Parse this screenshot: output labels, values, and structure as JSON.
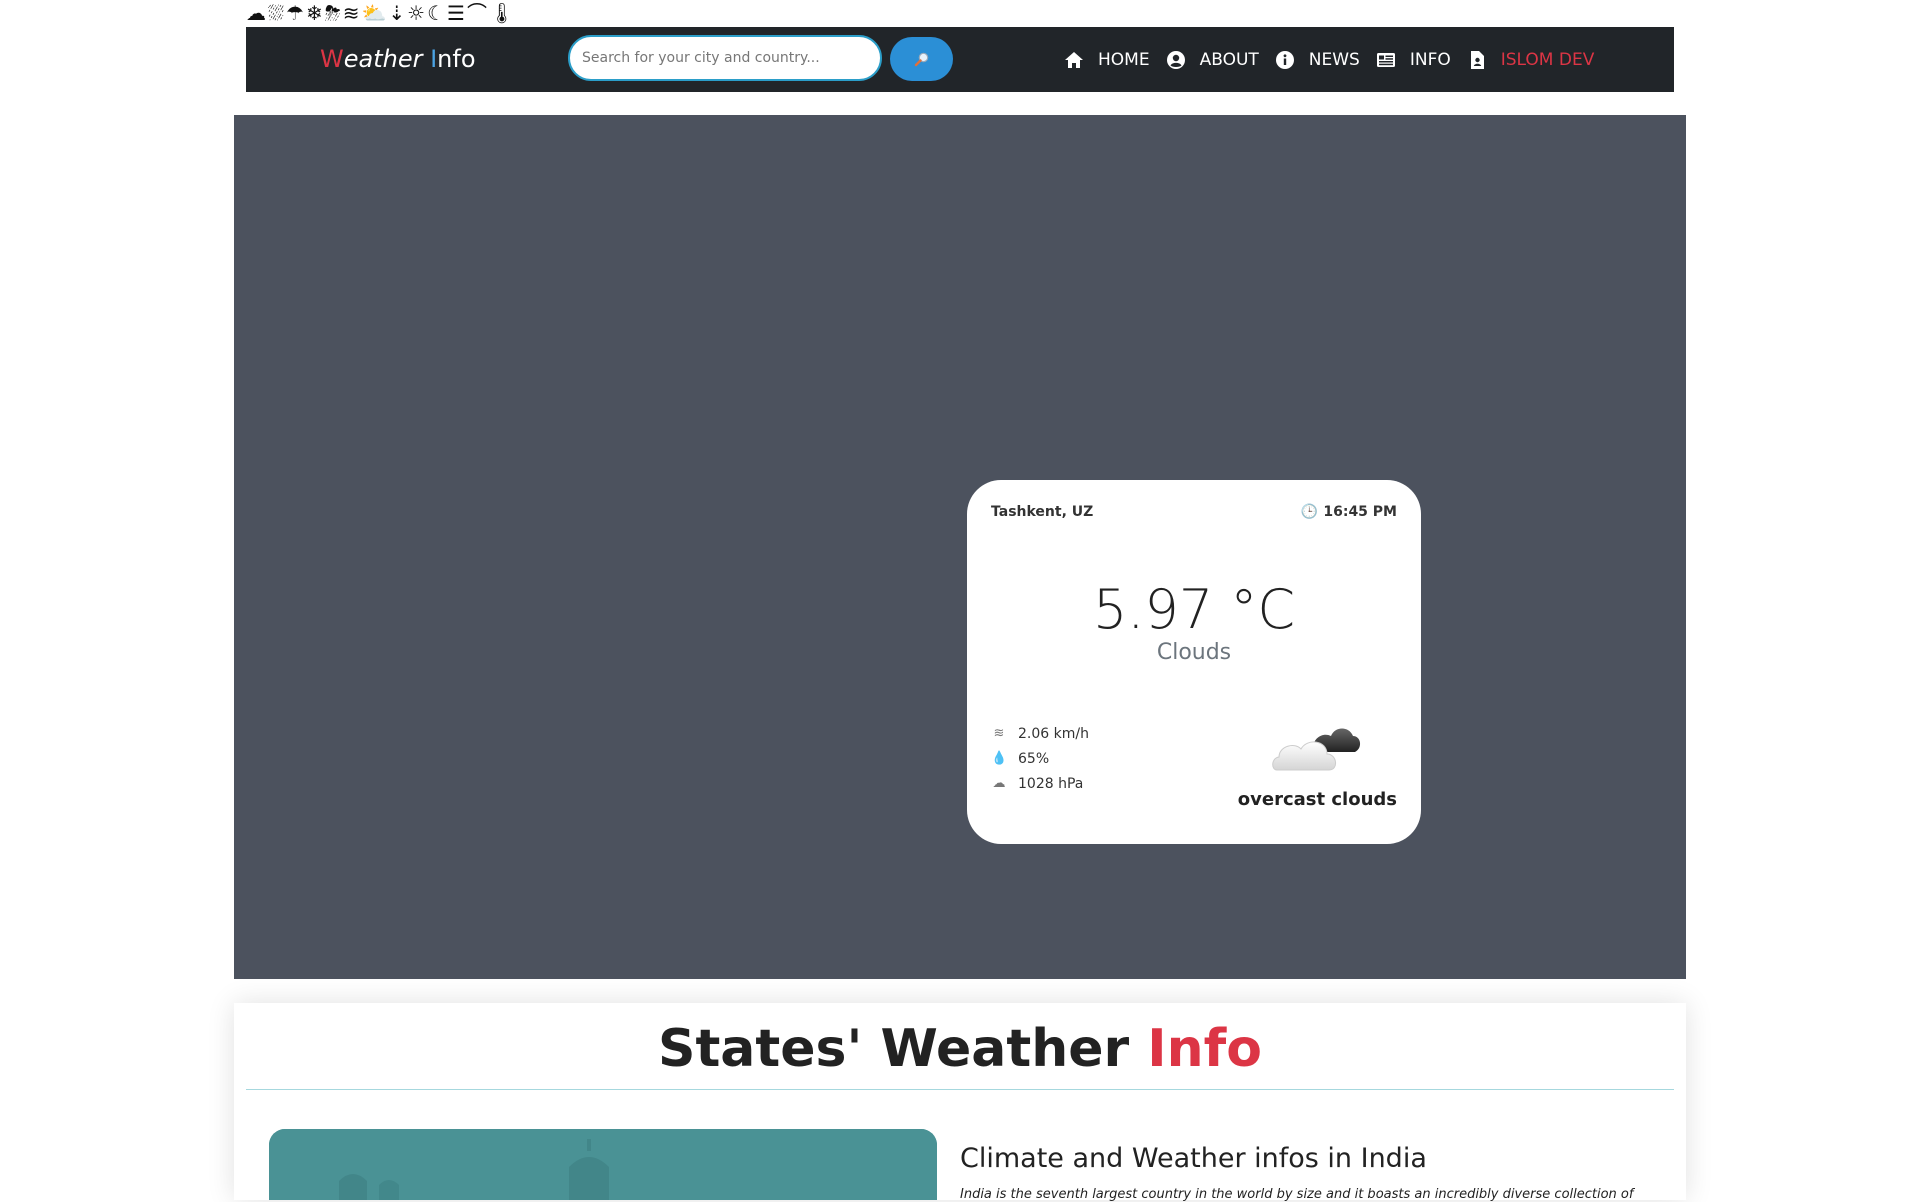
{
  "icon_strip": [
    "cloud-icon",
    "cloud-rain-icon",
    "cloud-showers-icon",
    "snowflake-icon",
    "cloud-hail-icon",
    "wind-icon",
    "cloud-sun-icon",
    "tornado-icon",
    "sun-icon",
    "cloud-moon-icon",
    "smog-icon",
    "rainbow-icon",
    "thermometer-icon"
  ],
  "icon_strip_glyphs": [
    "☁",
    "⛆",
    "☂",
    "❄",
    "⛈",
    "≋",
    "⛅",
    "⇣",
    "☼",
    "☾",
    "☰",
    "⌒",
    "🌡"
  ],
  "navbar": {
    "brand_w": "W",
    "brand_eather": "eather ",
    "brand_i": "I",
    "brand_nfo": "nfo",
    "search_placeholder": "Search for your city and country...",
    "items": [
      {
        "label": "HOME",
        "icon": "home-icon"
      },
      {
        "label": "ABOUT",
        "icon": "user-circle-icon"
      },
      {
        "label": "NEWS",
        "icon": "info-circle-icon"
      },
      {
        "label": "INFO",
        "icon": "newspaper-icon"
      },
      {
        "label": "ISLOM DEV",
        "icon": "file-user-icon"
      }
    ],
    "accent_color": "#dc3545"
  },
  "weather_card": {
    "location": "Tashkent, UZ",
    "time": "16:45 PM",
    "temperature": "5.97 °C",
    "condition": "Clouds",
    "wind": "2.06 km/h",
    "humidity": "65%",
    "pressure": "1028 hPa",
    "description": "overcast clouds",
    "weather_icon": "overcast-clouds-icon"
  },
  "states_section": {
    "title_main": "States' Weather ",
    "title_accent": "Info",
    "card_title": "Climate and Weather infos in India",
    "card_text": "India is the seventh largest country in the world by size and it boasts an incredibly diverse collection of"
  }
}
